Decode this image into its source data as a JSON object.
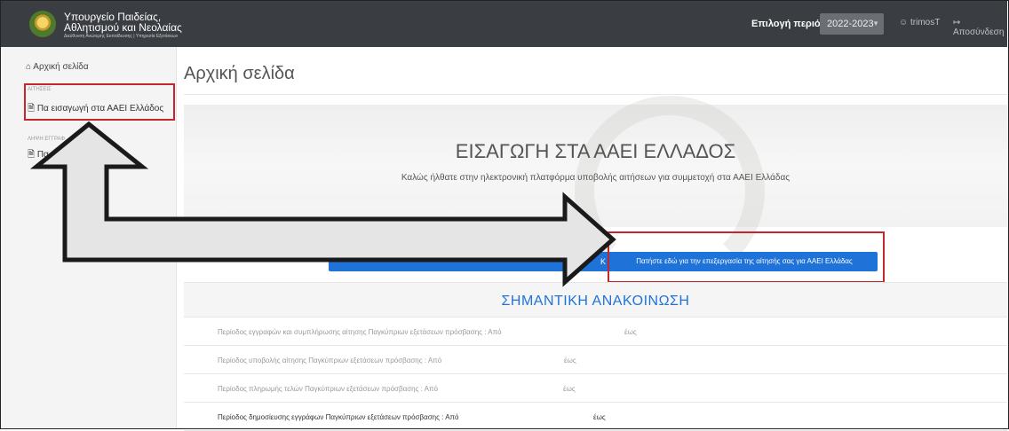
{
  "header": {
    "org_line1": "Υπουργείο Παιδείας,",
    "org_line2": "Αθλητισμού και Νεολαίας",
    "org_line3": "Διεύθυνση Ανώτερης Εκπαίδευσης | Υπηρεσία Εξετάσεων",
    "period_label": "Επιλογή περιόδου:",
    "period_value": "2022-2023",
    "user": "trimosT",
    "logout": "Αποσύνδεση"
  },
  "sidebar": {
    "home": "Αρχική σελίδα",
    "section1": "ΑΙΤΗΣΕΙΣ",
    "item1": "Πα εισαγωγή στα ΑΑΕΙ Ελλάδος",
    "section2": "ΛΗΨΗ ΕΓΓΡΑΦ",
    "item2": "Πα"
  },
  "main": {
    "title": "Αρχική σελίδα",
    "hero_title": "ΕΙΣΑΓΩΓΗ ΣΤΑ ΑΑΕΙ ΕΛΛΑΔΟΣ",
    "hero_subtitle": "Καλώς ήλθατε στην ηλεκτρονική πλατφόρμα υποβολής αιτήσεων για συμμετοχή στα ΑΑΕΙ Ελλάδας",
    "hidden_button_tail": "Κ",
    "main_button": "Πατήστε εδώ για την επεξεργασία της αίτησής σας για ΑΑΕΙ Ελλάδας",
    "announcement_title": "ΣΗΜΑΝΤΙΚΗ ΑΝΑΚΟΙΝΩΣΗ",
    "rows": [
      {
        "label": "Περίοδος εγγραφών και συμπλήρωσης αίτησης Παγκύπριων εξετάσεων πρόσβασης : Από",
        "until": "έως"
      },
      {
        "label": "Περίοδος υποβολής αίτησης Παγκύπριων εξετάσεων πρόσβασης : Από",
        "until": "έως"
      },
      {
        "label": "Περίοδος πληρωμής τελών Παγκύπριων εξετάσεων πρόσβασης : Από",
        "until": "έως"
      },
      {
        "label": "Περίοδος δημοσίευσης εγγράφων Παγκύπριων εξετάσεων πρόσβασης : Από",
        "until": "έως"
      }
    ]
  },
  "colors": {
    "topbar": "#3a3d42",
    "accent_blue": "#1f73d8",
    "highlight_red": "#c1272d"
  }
}
